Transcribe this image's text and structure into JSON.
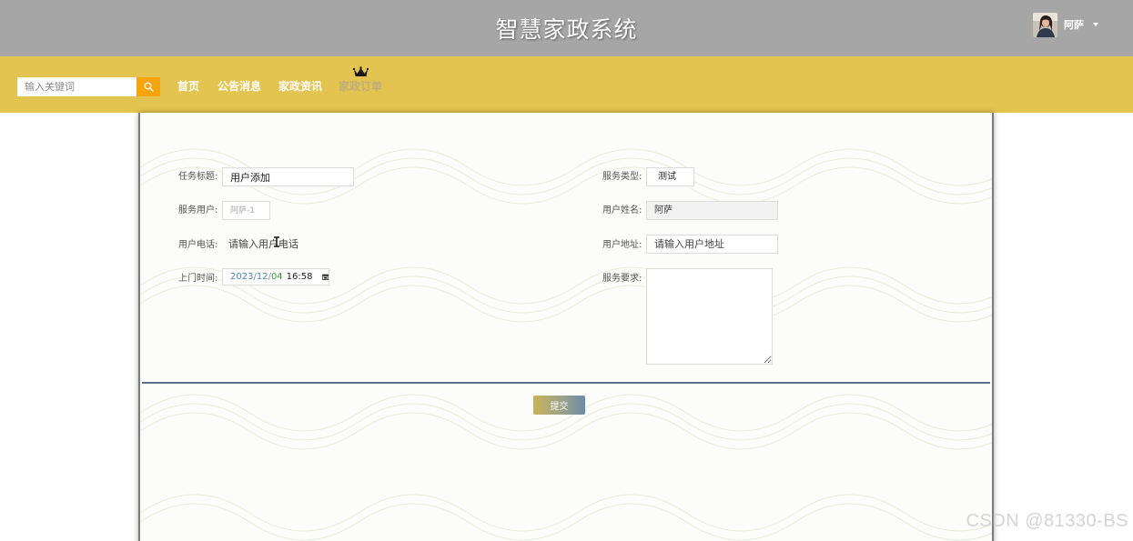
{
  "header": {
    "site_title": "智慧家政系统",
    "user_name": "阿萨",
    "avatar_icon": "user-avatar",
    "dropdown_icon": "caret-down-icon"
  },
  "nav": {
    "search_placeholder": "输入关键词",
    "search_icon": "search-icon",
    "items": [
      {
        "label": "首页"
      },
      {
        "label": "公告消息"
      },
      {
        "label": "家政资讯"
      },
      {
        "label": "家政订单",
        "active": true,
        "icon": "crown-icon"
      }
    ]
  },
  "form": {
    "task_title": {
      "label": "任务标题:",
      "value": "用户添加"
    },
    "service_type": {
      "label": "服务类型:",
      "value": "测试"
    },
    "service_user": {
      "label": "服务用户:",
      "placeholder": "阿萨-1"
    },
    "user_name": {
      "label": "用户姓名:",
      "placeholder": "阿萨"
    },
    "user_phone": {
      "label": "用户电话:",
      "placeholder": "请输入用户电话"
    },
    "user_address": {
      "label": "用户地址:",
      "placeholder": "请输入用户地址"
    },
    "visit_time": {
      "label": "上门时间:",
      "year": "2023",
      "month": "12",
      "day": "04",
      "time": "16:58",
      "icon": "calendar-icon"
    },
    "service_requirements": {
      "label": "服务要求:",
      "value": ""
    },
    "submit_label": "提交"
  },
  "watermark": "CSDN @81330-BS",
  "colors": {
    "top_bar": "#a6a6a6",
    "nav_bar": "#e4c450",
    "search_button": "#f5a50b",
    "divider": "#5d6f86"
  }
}
